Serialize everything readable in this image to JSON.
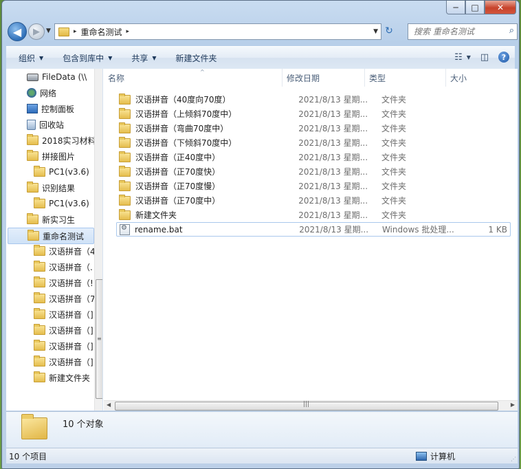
{
  "window": {
    "caption": {
      "minimize": "─",
      "maximize": "□",
      "close": "✕"
    }
  },
  "nav": {
    "back_glyph": "◀",
    "forward_glyph": "▶",
    "dropdown_glyph": "▼",
    "address": {
      "crumb": "重命名测试",
      "sep": "▸",
      "dropdown": "▼"
    },
    "refresh_glyph": "↻",
    "search_placeholder": "搜索 重命名测试",
    "search_icon": "⌕"
  },
  "toolbar": {
    "items": [
      "组织",
      "包含到库中",
      "共享",
      "新建文件夹"
    ],
    "arrow": "▼",
    "view_glyph": "☷",
    "pane_glyph": "◫",
    "help_glyph": "?"
  },
  "sidebar": {
    "items": [
      {
        "label": "FileData (\\\\",
        "icon": "drive-icon"
      },
      {
        "label": "网络",
        "icon": "network-icon"
      },
      {
        "label": "控制面板",
        "icon": "control-panel-icon"
      },
      {
        "label": "回收站",
        "icon": "recycle-bin-icon"
      },
      {
        "label": "2018实习材料",
        "icon": "folder-icon"
      },
      {
        "label": "拼接图片",
        "icon": "folder-icon"
      },
      {
        "label": "PC1(v3.6)",
        "icon": "folder-icon"
      },
      {
        "label": "识别结果",
        "icon": "folder-icon"
      },
      {
        "label": "PC1(v3.6)",
        "icon": "folder-icon"
      },
      {
        "label": "新实习生",
        "icon": "folder-icon"
      },
      {
        "label": "重命名测试",
        "icon": "folder-icon",
        "selected": true
      },
      {
        "label": "汉语拼音（4",
        "icon": "folder-icon"
      },
      {
        "label": "汉语拼音（.",
        "icon": "folder-icon"
      },
      {
        "label": "汉语拼音（!",
        "icon": "folder-icon"
      },
      {
        "label": "汉语拼音（7",
        "icon": "folder-icon"
      },
      {
        "label": "汉语拼音（]",
        "icon": "folder-icon"
      },
      {
        "label": "汉语拼音（]",
        "icon": "folder-icon"
      },
      {
        "label": "汉语拼音（]",
        "icon": "folder-icon"
      },
      {
        "label": "汉语拼音（]",
        "icon": "folder-icon"
      },
      {
        "label": "新建文件夹",
        "icon": "folder-icon"
      }
    ],
    "scroll_grip": "≡"
  },
  "columns": {
    "name": "名称",
    "date": "修改日期",
    "type": "类型",
    "size": "大小",
    "sort_glyph": "^"
  },
  "files": [
    {
      "name": "汉语拼音（40度向70度）",
      "date": "2021/8/13 星期...",
      "type": "文件夹",
      "size": "",
      "icon": "folder-icon"
    },
    {
      "name": "汉语拼音（上倾斜70度中）",
      "date": "2021/8/13 星期...",
      "type": "文件夹",
      "size": "",
      "icon": "folder-icon"
    },
    {
      "name": "汉语拼音（弯曲70度中）",
      "date": "2021/8/13 星期...",
      "type": "文件夹",
      "size": "",
      "icon": "folder-icon"
    },
    {
      "name": "汉语拼音（下倾斜70度中）",
      "date": "2021/8/13 星期...",
      "type": "文件夹",
      "size": "",
      "icon": "folder-icon"
    },
    {
      "name": "汉语拼音（正40度中）",
      "date": "2021/8/13 星期...",
      "type": "文件夹",
      "size": "",
      "icon": "folder-icon"
    },
    {
      "name": "汉语拼音（正70度快）",
      "date": "2021/8/13 星期...",
      "type": "文件夹",
      "size": "",
      "icon": "folder-icon"
    },
    {
      "name": "汉语拼音（正70度慢）",
      "date": "2021/8/13 星期...",
      "type": "文件夹",
      "size": "",
      "icon": "folder-icon"
    },
    {
      "name": "汉语拼音（正70度中）",
      "date": "2021/8/13 星期...",
      "type": "文件夹",
      "size": "",
      "icon": "folder-icon"
    },
    {
      "name": "新建文件夹",
      "date": "2021/8/13 星期...",
      "type": "文件夹",
      "size": "",
      "icon": "folder-icon"
    },
    {
      "name": "rename.bat",
      "date": "2021/8/13 星期...",
      "type": "Windows 批处理...",
      "size": "1 KB",
      "icon": "batch-file-icon"
    }
  ],
  "hscroll": {
    "left": "◀",
    "right": "▶",
    "grip": "|||"
  },
  "details": {
    "text": "10 个对象"
  },
  "status": {
    "left": "10 个项目",
    "right": "计算机",
    "grip": "⋰"
  }
}
